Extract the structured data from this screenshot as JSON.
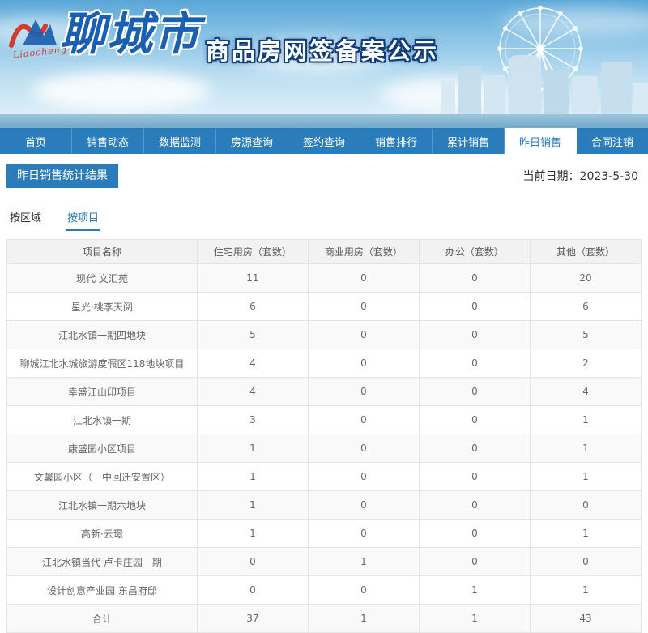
{
  "banner": {
    "logo_script": "Liaocheng",
    "logo_city": "聊城市",
    "site_title": "商品房网签备案公示"
  },
  "nav": {
    "items": [
      {
        "label": "首页",
        "active": false
      },
      {
        "label": "销售动态",
        "active": false
      },
      {
        "label": "数据监测",
        "active": false
      },
      {
        "label": "房源查询",
        "active": false
      },
      {
        "label": "签约查询",
        "active": false
      },
      {
        "label": "销售排行",
        "active": false
      },
      {
        "label": "累计销售",
        "active": false
      },
      {
        "label": "昨日销售",
        "active": true
      },
      {
        "label": "合同注销",
        "active": false
      }
    ]
  },
  "content": {
    "section_title": "昨日销售统计结果",
    "date_label": "当前日期：",
    "date_value": "2023-5-30",
    "tabs": [
      {
        "label": "按区域",
        "active": false
      },
      {
        "label": "按项目",
        "active": true
      }
    ]
  },
  "table": {
    "headers": [
      "项目名称",
      "住宅用房（套数）",
      "商业用房（套数）",
      "办公（套数）",
      "其他（套数）"
    ],
    "rows": [
      {
        "name": "现代 文汇苑",
        "values": [
          "11",
          "0",
          "0",
          "20"
        ],
        "total": false
      },
      {
        "name": "星光·桃李天阅",
        "values": [
          "6",
          "0",
          "0",
          "6"
        ],
        "total": false
      },
      {
        "name": "江北水镇一期四地块",
        "values": [
          "5",
          "0",
          "0",
          "5"
        ],
        "total": false
      },
      {
        "name": "聊城江北水城旅游度假区118地块项目",
        "values": [
          "4",
          "0",
          "0",
          "2"
        ],
        "total": false
      },
      {
        "name": "幸盛江山印项目",
        "values": [
          "4",
          "0",
          "0",
          "4"
        ],
        "total": false
      },
      {
        "name": "江北水镇一期",
        "values": [
          "3",
          "0",
          "0",
          "1"
        ],
        "total": false
      },
      {
        "name": "康盛园小区项目",
        "values": [
          "1",
          "0",
          "0",
          "1"
        ],
        "total": false
      },
      {
        "name": "文馨园小区（一中回迁安置区）",
        "values": [
          "1",
          "0",
          "0",
          "1"
        ],
        "total": false
      },
      {
        "name": "江北水镇一期六地块",
        "values": [
          "1",
          "0",
          "0",
          "0"
        ],
        "total": false
      },
      {
        "name": "高新·云璟",
        "values": [
          "1",
          "0",
          "0",
          "1"
        ],
        "total": false
      },
      {
        "name": "江北水镇当代 卢卡庄园一期",
        "values": [
          "0",
          "1",
          "0",
          "0"
        ],
        "total": false
      },
      {
        "name": "设计创意产业园 东昌府邸",
        "values": [
          "0",
          "0",
          "1",
          "1"
        ],
        "total": false
      },
      {
        "name": "合计",
        "values": [
          "37",
          "1",
          "1",
          "43"
        ],
        "total": true
      }
    ]
  },
  "colors": {
    "primary_blue": "#2a7cba",
    "title_outline_navy": "#0f3d7c",
    "logo_blue": "#1b5fb0",
    "logo_red": "#d23b2e",
    "table_border": "#e5e5e5",
    "table_header_bg": "#f2f2f2"
  }
}
